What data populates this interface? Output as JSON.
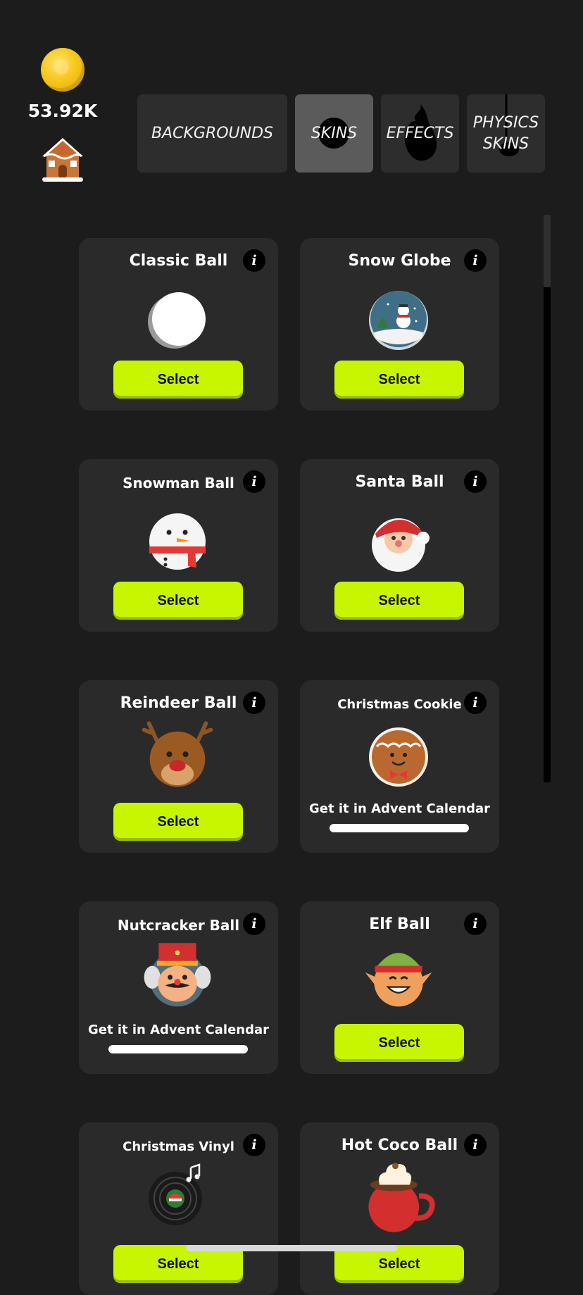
{
  "header": {
    "coin_icon": "coin-icon",
    "coins": "53.92K",
    "house_icon": "gingerbread-house-icon"
  },
  "tabs": [
    {
      "label": "BACKGROUNDS",
      "active": false
    },
    {
      "label": "SKINS",
      "active": true
    },
    {
      "label": "EFFECTS",
      "active": false
    },
    {
      "label": "PHYSICS\nSKINS",
      "active": false
    }
  ],
  "cards": [
    {
      "title": "Classic Ball",
      "icon": "classic-ball-icon",
      "action": "Select"
    },
    {
      "title": "Snow Globe",
      "icon": "snow-globe-icon",
      "action": "Select"
    },
    {
      "title": "Snowman Ball",
      "icon": "snowman-ball-icon",
      "action": "Select"
    },
    {
      "title": "Santa Ball",
      "icon": "santa-ball-icon",
      "action": "Select"
    },
    {
      "title": "Reindeer Ball",
      "icon": "reindeer-ball-icon",
      "action": "Select"
    },
    {
      "title": "Christmas Cookie",
      "icon": "gingerbread-cookie-icon",
      "locked_text": "Get it in Advent Calendar"
    },
    {
      "title": "Nutcracker Ball",
      "icon": "nutcracker-ball-icon",
      "locked_text": "Get it in Advent Calendar"
    },
    {
      "title": "Elf Ball",
      "icon": "elf-ball-icon",
      "action": "Select"
    },
    {
      "title": "Christmas Vinyl",
      "icon": "christmas-vinyl-icon",
      "action": "Select"
    },
    {
      "title": "Hot Coco Ball",
      "icon": "hot-cocoa-mug-icon",
      "action": "Select"
    }
  ],
  "info_label": "i",
  "colors": {
    "background": "#1c1c1c",
    "card": "#2a2a2a",
    "accent": "#c8f500",
    "tab": "#2d2d2d",
    "tab_active": "#5b5b5b"
  }
}
